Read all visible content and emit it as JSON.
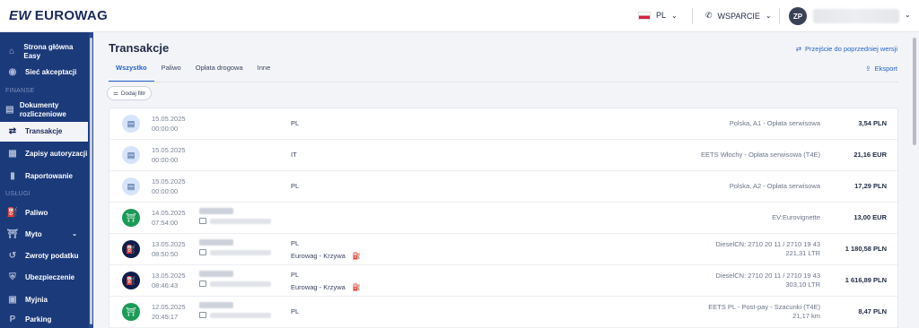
{
  "brand": {
    "logo_mark": "EW",
    "logo_text": "EUROWAG"
  },
  "topbar": {
    "language": "PL",
    "support_label": "WSPARCIE",
    "avatar_initials": "ZP",
    "icons": {
      "support": "phone-icon",
      "dropdown": "chevron-down-icon"
    }
  },
  "sidebar": {
    "items": [
      {
        "label": "Strona główna Easy",
        "icon": "home-icon"
      },
      {
        "label": "Sieć akceptacji",
        "icon": "location-pin-icon"
      },
      {
        "section": "FINANSE"
      },
      {
        "label": "Dokumenty rozliczeniowe",
        "icon": "document-icon"
      },
      {
        "label": "Transakcje",
        "icon": "transfer-arrows-icon",
        "active": true
      },
      {
        "label": "Zapisy autoryzacji",
        "icon": "list-icon"
      },
      {
        "label": "Raportowanie",
        "icon": "chart-icon"
      },
      {
        "section": "USŁUGI"
      },
      {
        "label": "Paliwo",
        "icon": "fuel-icon"
      },
      {
        "label": "Myto",
        "icon": "toll-icon",
        "expandable": true
      },
      {
        "label": "Zwroty podatku",
        "icon": "tax-refund-icon"
      },
      {
        "label": "Ubezpieczenie",
        "icon": "shield-icon"
      },
      {
        "label": "Myjnia",
        "icon": "wash-icon"
      },
      {
        "label": "Parking",
        "icon": "parking-icon"
      }
    ]
  },
  "main": {
    "title": "Transakcje",
    "prev_version_link": "Przejście do poprzedniej wersji",
    "tabs": [
      "Wszystko",
      "Paliwo",
      "Opłata drogowa",
      "Inne"
    ],
    "active_tab": "Wszystko",
    "export_label": "Eksport",
    "filter_label": "Dodaj filtr"
  },
  "transactions": [
    {
      "icon": "document-icon",
      "icon_style": "doc",
      "date": "15.05.2025",
      "time": "00:00:00",
      "country": "PL",
      "station": "",
      "description": "Polska, A1 - Opłata serwisowa",
      "sub": "",
      "amount": "3,54 PLN",
      "blurred": false
    },
    {
      "icon": "document-icon",
      "icon_style": "doc",
      "date": "15.05.2025",
      "time": "00:00:00",
      "country": "IT",
      "station": "",
      "description": "EETS Włochy - Opłata serwisowa (T4E)",
      "sub": "",
      "amount": "21,16 EUR",
      "blurred": false
    },
    {
      "icon": "document-icon",
      "icon_style": "doc",
      "date": "15.05.2025",
      "time": "00:00:00",
      "country": "PL",
      "station": "",
      "description": "Polska, A2 - Opłata serwisowa",
      "sub": "",
      "amount": "17,29 PLN",
      "blurred": false
    },
    {
      "icon": "toll-gate-icon",
      "icon_style": "green",
      "date": "14.05.2025",
      "time": "07:54:00",
      "country": "",
      "station": "",
      "description": "EV:Eurovignette",
      "sub": "",
      "amount": "13,00 EUR",
      "blurred": true
    },
    {
      "icon": "fuel-pump-icon",
      "icon_style": "navy",
      "date": "13.05.2025",
      "time": "08:50:50",
      "country": "PL",
      "station": "Eurowag - Krzywa",
      "description": "DieselCN: 2710 20 11 / 2710 19 43",
      "sub": "221,31 LTR",
      "amount": "1 180,58 PLN",
      "blurred": true
    },
    {
      "icon": "fuel-pump-icon",
      "icon_style": "navy",
      "date": "13.05.2025",
      "time": "08:46:43",
      "country": "PL",
      "station": "Eurowag - Krzywa",
      "description": "DieselCN: 2710 20 11 / 2710 19 43",
      "sub": "303,10 LTR",
      "amount": "1 616,89 PLN",
      "blurred": true
    },
    {
      "icon": "toll-gate-icon",
      "icon_style": "green",
      "date": "12.05.2025",
      "time": "20:45:17",
      "country": "PL",
      "station": "",
      "description": "EETS PL - Post-pay - Szacunki (T4E)",
      "sub": "21,17 km",
      "amount": "8,47 PLN",
      "blurred": true
    }
  ]
}
